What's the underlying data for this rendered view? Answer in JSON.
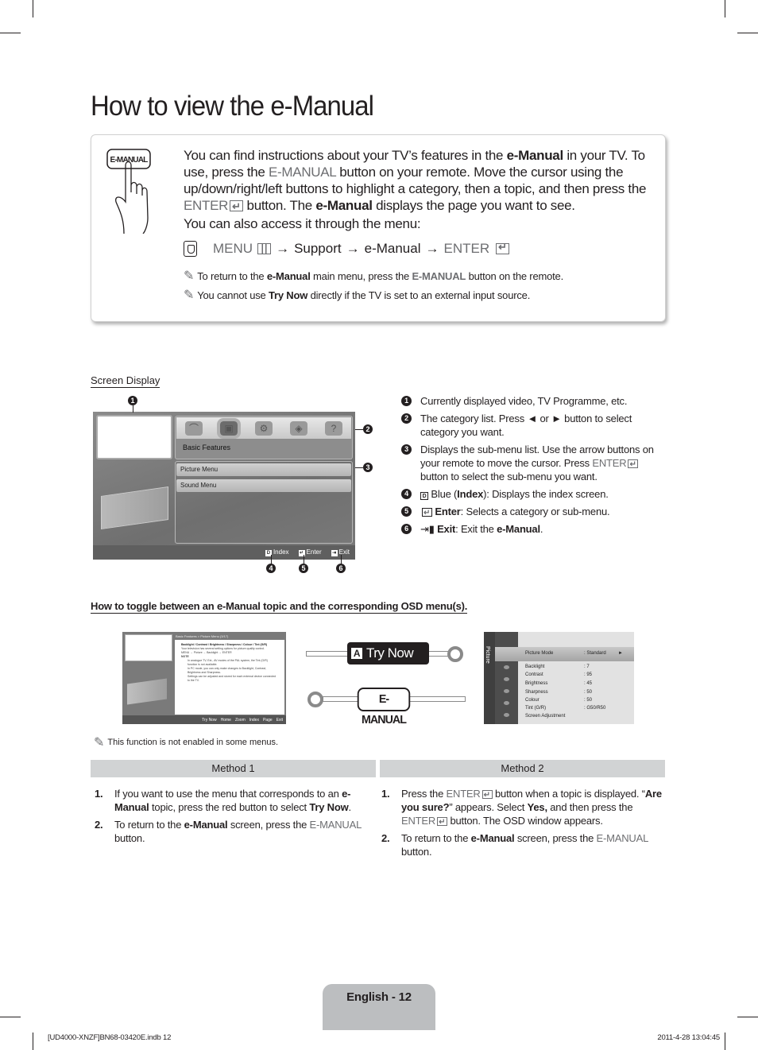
{
  "title": "How to view the e-Manual",
  "intro": {
    "hand_button_label": "E-MANUAL",
    "para1": {
      "t1": "You can find instructions about your TV’s features in the ",
      "b1": "e-Manual",
      "t2": " in your TV. To use, press the ",
      "g1": "E-MANUAL",
      "t3": " button on your remote. Move the cursor using the up/down/right/left buttons to highlight a category, then a topic, and then press the ",
      "g2": "ENTER",
      "t4": " button. The ",
      "b2": "e-Manual",
      "t5": " displays the page you want to see."
    },
    "para2": "You can also access it through the menu:",
    "menu_path": {
      "menu": "MENU",
      "arrow": "→",
      "support": "Support",
      "emanual": "e-Manual",
      "enter": "ENTER"
    },
    "notes": [
      {
        "t1": "To return to the ",
        "b1": "e-Manual",
        "t2": " main menu, press the ",
        "g1": "E-MANUAL",
        "t3": " button on the remote."
      },
      {
        "t1": "You cannot use ",
        "b1": "Try Now",
        "t2": " directly if the TV is set to an external input source."
      }
    ]
  },
  "screen_display": {
    "label": "Screen Display",
    "tv": {
      "category_name": "Basic Features",
      "category_icons": [
        "satellite-dish-icon",
        "tv-features-icon",
        "tools-gear-icon",
        "network-icon",
        "help-icon"
      ],
      "selected_category_index": 1,
      "submenu": [
        "Picture Menu",
        "Sound Menu"
      ],
      "footer": [
        {
          "key": "D",
          "label": "Index"
        },
        {
          "key": "enter",
          "label": "Enter"
        },
        {
          "key": "exit",
          "label": "Exit"
        }
      ]
    },
    "callouts": [
      "1",
      "2",
      "3",
      "4",
      "5",
      "6"
    ],
    "legend": [
      {
        "num": "1",
        "text": "Currently displayed video, TV Programme, etc."
      },
      {
        "num": "2",
        "text": "The category list. Press ◄ or ► button to select category you want."
      },
      {
        "num": "3",
        "t1": "Displays the sub-menu list. Use the arrow buttons on your remote to move the cursor. Press ",
        "g1": "ENTER",
        "t2": " button to select the sub-menu you want."
      },
      {
        "num": "4",
        "key": "D",
        "t1": " Blue (",
        "b1": "Index",
        "t2": "): Displays the index screen."
      },
      {
        "num": "5",
        "b1": "Enter",
        "t2": ": Selects a category or sub-menu."
      },
      {
        "num": "6",
        "b1": "Exit",
        "t2": ": Exit the ",
        "b2": "e-Manual",
        "t3": "."
      }
    ]
  },
  "toggle": {
    "heading": "How to toggle between an e-Manual topic and the corresponding OSD menu(s).",
    "thumb1": {
      "breadcrumb": "Basic Features > Picture Menu (3/17)",
      "topic": "Backlight / Contrast / Brightness / Sharpness / Colour / Tint (G/R)",
      "desc": "Your television has several setting options for picture quality control.",
      "path": "MENU → Picture → Backlight → ENTER",
      "note_label": "NOTE",
      "bullets": [
        "In analogue TV, Ext., AV modes of the PAL system, the Tint (G/R) function is not available.",
        "In PC mode, you can only make changes to Backlight, Contrast, Brightness and Sharpness.",
        "Settings can be adjusted and stored for each external device connected to the TV."
      ],
      "footer": [
        "Try Now",
        "Home",
        "Zoom",
        "Index",
        "Page",
        "Exit"
      ]
    },
    "try_now_key": "A",
    "try_now_label": "Try Now",
    "emanual_label": "E-MANUAL",
    "osd": {
      "tab": "Picture",
      "rows": [
        {
          "label": "Picture Mode",
          "value": ": Standard",
          "selected": true
        },
        {
          "label": "Backlight",
          "value": ": 7"
        },
        {
          "label": "Contrast",
          "value": ": 95"
        },
        {
          "label": "Brightness",
          "value": ": 45"
        },
        {
          "label": "Sharpness",
          "value": ": 50"
        },
        {
          "label": "Colour",
          "value": ": 50"
        },
        {
          "label": "Tint (G/R)",
          "value": ": G50/R50"
        },
        {
          "label": "Screen Adjustment",
          "value": ""
        }
      ]
    },
    "note": "This function is not enabled in some menus."
  },
  "methods": [
    {
      "heading": "Method 1",
      "steps": [
        {
          "num": "1.",
          "t1": "If you want to use the menu that corresponds to an ",
          "b1": "e-Manual",
          "t2": " topic, press the red button to select ",
          "b2": "Try Now",
          "t3": "."
        },
        {
          "num": "2.",
          "t1": "To return to the ",
          "b1": "e-Manual",
          "t2": " screen, press the ",
          "g1": "E-MANUAL",
          "t3": " button."
        }
      ]
    },
    {
      "heading": "Method 2",
      "steps": [
        {
          "num": "1.",
          "t1": "Press the ",
          "g1": "ENTER",
          "t2": " button when a topic is displayed. “",
          "b1": "Are you sure?",
          "t3": "” appears. Select ",
          "b2": "Yes,",
          "t4": " and then press the ",
          "g2": "ENTER",
          "t5": " button. The OSD window appears."
        },
        {
          "num": "2.",
          "t1": "To return to the ",
          "b1": "e-Manual",
          "t2": " screen, press the ",
          "g1": "E-MANUAL",
          "t3": " button."
        }
      ]
    }
  ],
  "footer": {
    "page_label": "English - 12",
    "slug_left": "[UD4000-XNZF]BN68-03420E.indb   12",
    "slug_right": "2011-4-28   13:04:45"
  }
}
